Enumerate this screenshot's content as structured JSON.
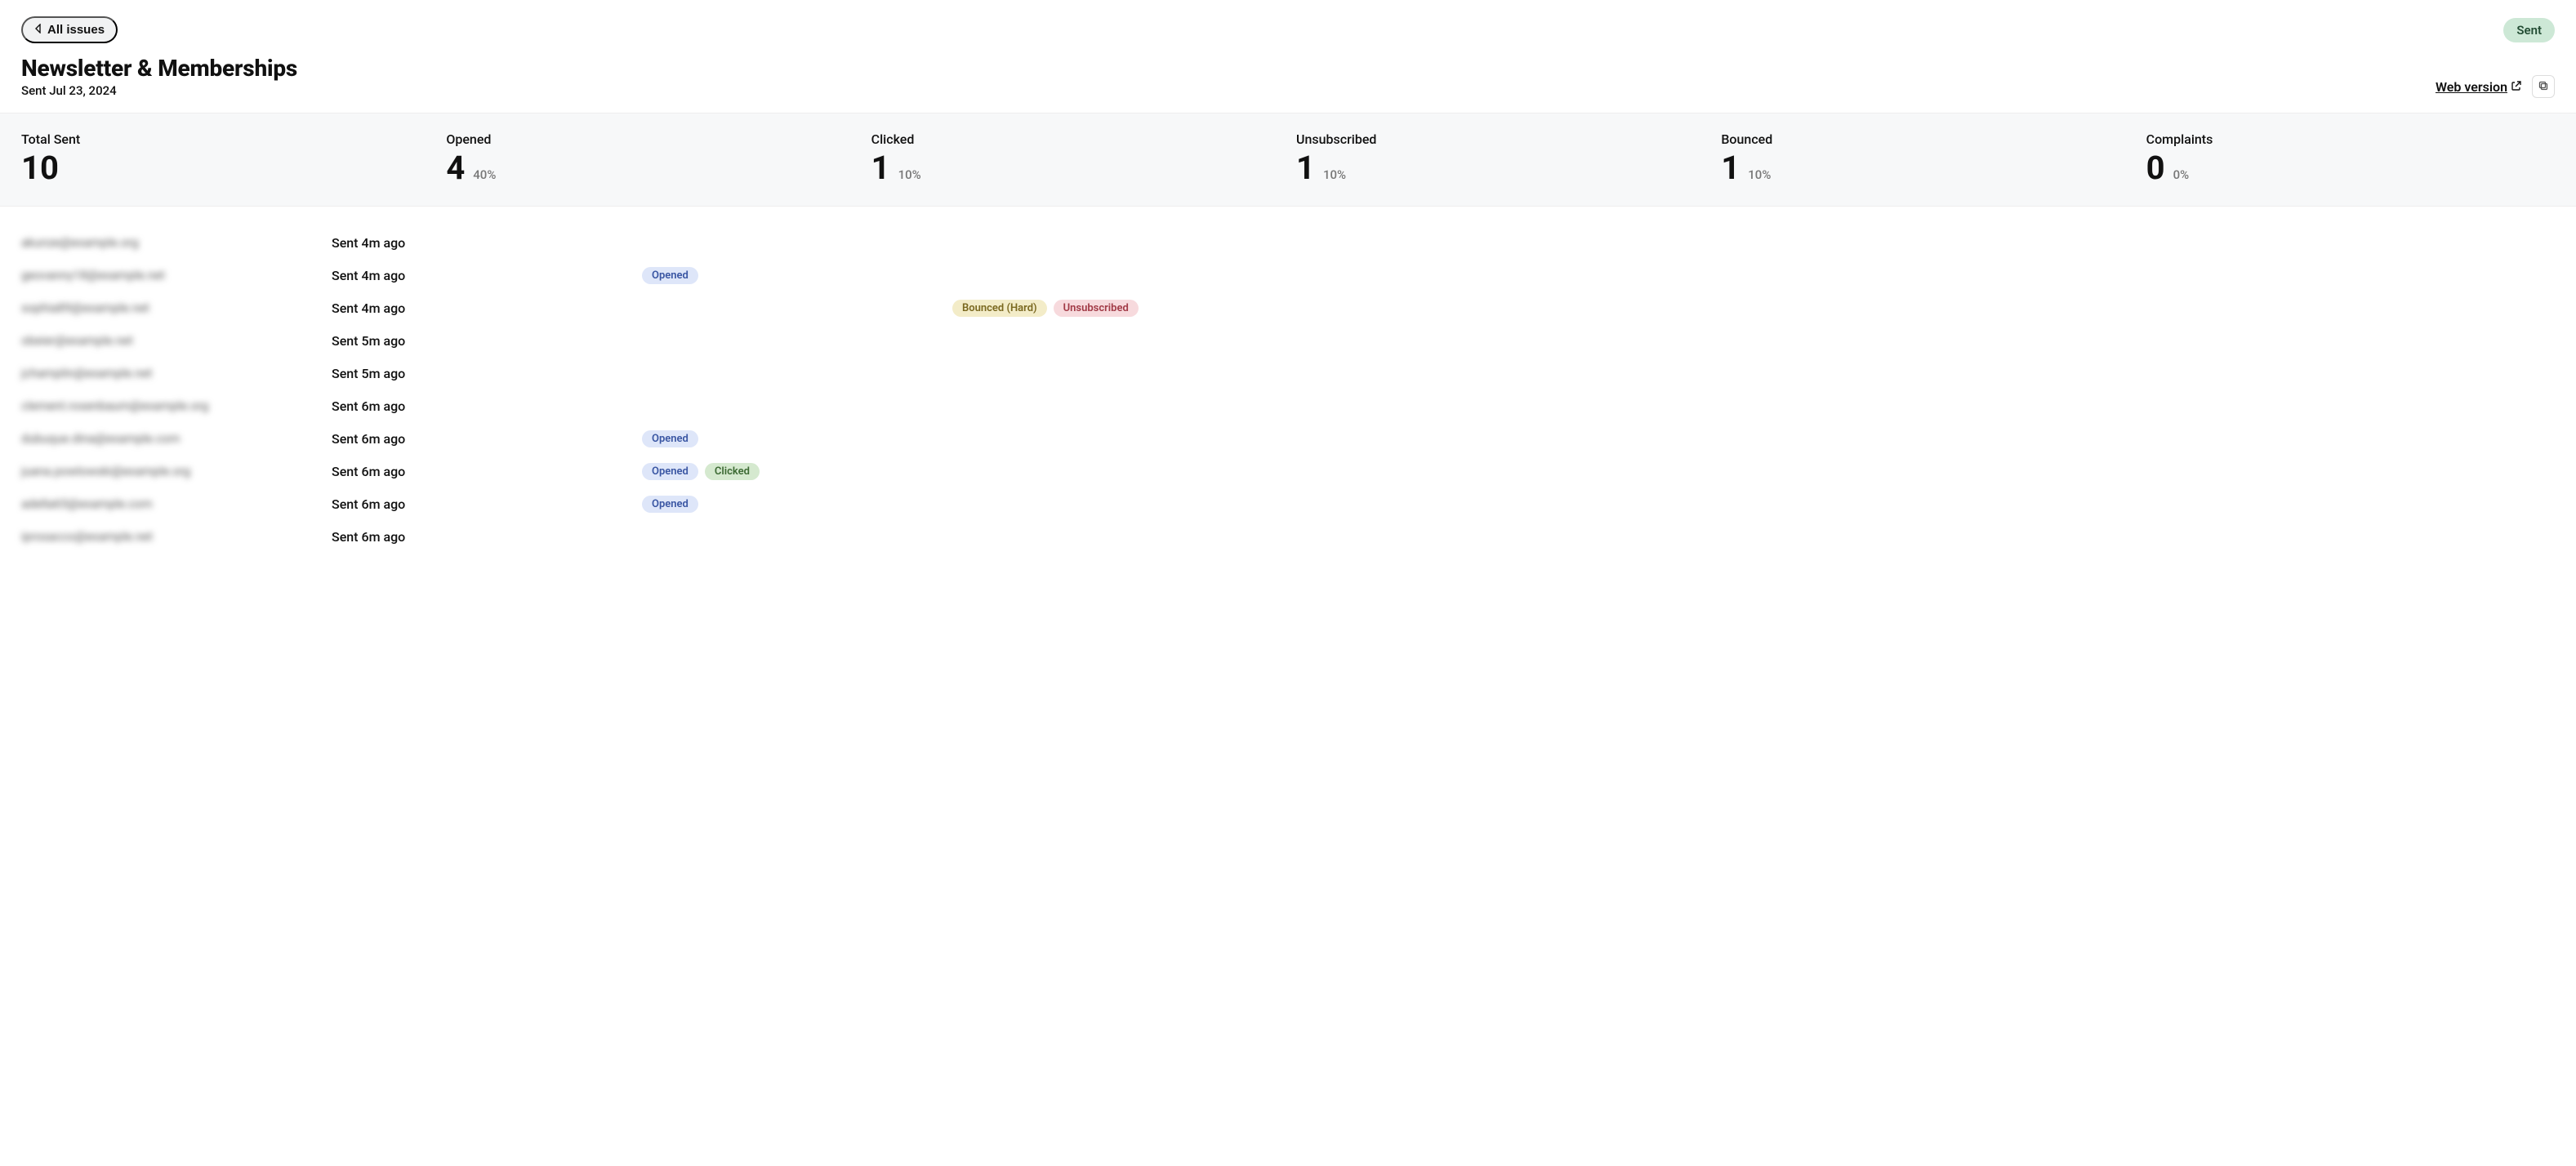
{
  "nav": {
    "back_label": "All issues"
  },
  "status_badge": "Sent",
  "page_title": "Newsletter & Memberships",
  "subtitle": "Sent Jul 23, 2024",
  "web_version_label": "Web version",
  "stats": [
    {
      "label": "Total Sent",
      "value": "10",
      "pct": ""
    },
    {
      "label": "Opened",
      "value": "4",
      "pct": "40%"
    },
    {
      "label": "Clicked",
      "value": "1",
      "pct": "10%"
    },
    {
      "label": "Unsubscribed",
      "value": "1",
      "pct": "10%"
    },
    {
      "label": "Bounced",
      "value": "1",
      "pct": "10%"
    },
    {
      "label": "Complaints",
      "value": "0",
      "pct": "0%"
    }
  ],
  "badge_text": {
    "opened": "Opened",
    "clicked": "Clicked",
    "bounced_hard": "Bounced (Hard)",
    "unsubscribed": "Unsubscribed"
  },
  "recipients": [
    {
      "email": "akunze@example.org",
      "sent": "Sent 4m ago",
      "opened": false,
      "clicked": false,
      "bounced": false,
      "unsub": false
    },
    {
      "email": "geovanny18@example.net",
      "sent": "Sent 4m ago",
      "opened": true,
      "clicked": false,
      "bounced": false,
      "unsub": false
    },
    {
      "email": "sophia89@example.net",
      "sent": "Sent 4m ago",
      "opened": false,
      "clicked": false,
      "bounced": true,
      "unsub": true
    },
    {
      "email": "obeier@example.net",
      "sent": "Sent 5m ago",
      "opened": false,
      "clicked": false,
      "bounced": false,
      "unsub": false
    },
    {
      "email": "jchamplin@example.net",
      "sent": "Sent 5m ago",
      "opened": false,
      "clicked": false,
      "bounced": false,
      "unsub": false
    },
    {
      "email": "clement.rosenbaum@example.org",
      "sent": "Sent 6m ago",
      "opened": false,
      "clicked": false,
      "bounced": false,
      "unsub": false
    },
    {
      "email": "dubuque.dina@example.com",
      "sent": "Sent 6m ago",
      "opened": true,
      "clicked": false,
      "bounced": false,
      "unsub": false
    },
    {
      "email": "juana.powlowski@example.org",
      "sent": "Sent 6m ago",
      "opened": true,
      "clicked": true,
      "bounced": false,
      "unsub": false
    },
    {
      "email": "adella65@example.com",
      "sent": "Sent 6m ago",
      "opened": true,
      "clicked": false,
      "bounced": false,
      "unsub": false
    },
    {
      "email": "iprosacco@example.net",
      "sent": "Sent 6m ago",
      "opened": false,
      "clicked": false,
      "bounced": false,
      "unsub": false
    }
  ]
}
